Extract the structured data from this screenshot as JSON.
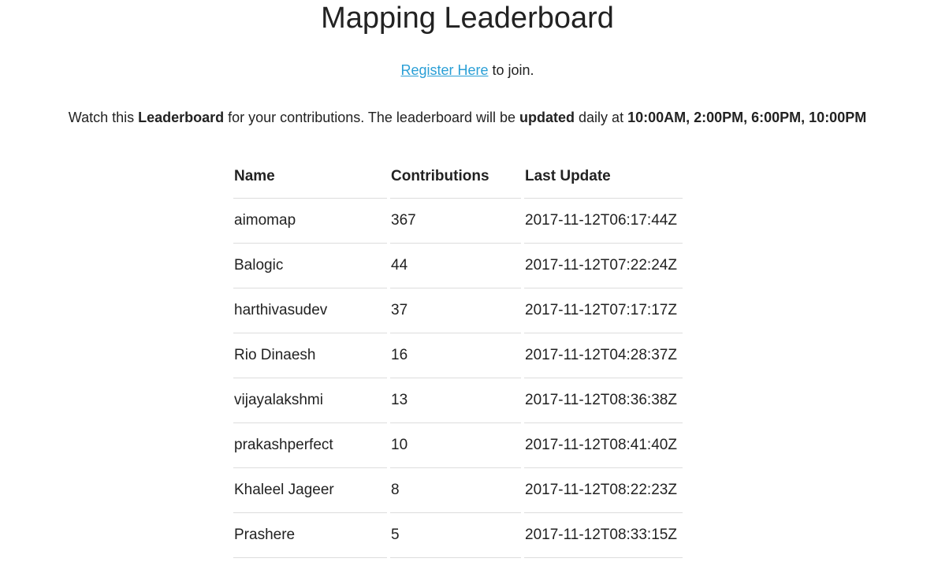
{
  "page": {
    "title": "Mapping Leaderboard"
  },
  "register": {
    "link_text": "Register Here",
    "suffix": " to join."
  },
  "info": {
    "part1": "Watch this ",
    "bold1": "Leaderboard",
    "part2": " for your contributions. The leaderboard will be ",
    "bold2": "updated",
    "part3": " daily at ",
    "bold3": "10:00AM, 2:00PM, 6:00PM, 10:00PM"
  },
  "table": {
    "headers": [
      "Name",
      "Contributions",
      "Last Update"
    ],
    "rows": [
      {
        "name": "aimomap",
        "contributions": "367",
        "last_update": "2017-11-12T06:17:44Z"
      },
      {
        "name": "Balogic",
        "contributions": "44",
        "last_update": "2017-11-12T07:22:24Z"
      },
      {
        "name": "harthivasudev",
        "contributions": "37",
        "last_update": "2017-11-12T07:17:17Z"
      },
      {
        "name": "Rio Dinaesh",
        "contributions": "16",
        "last_update": "2017-11-12T04:28:37Z"
      },
      {
        "name": "vijayalakshmi",
        "contributions": "13",
        "last_update": "2017-11-12T08:36:38Z"
      },
      {
        "name": "prakashperfect",
        "contributions": "10",
        "last_update": "2017-11-12T08:41:40Z"
      },
      {
        "name": "Khaleel Jageer",
        "contributions": "8",
        "last_update": "2017-11-12T08:22:23Z"
      },
      {
        "name": "Prashere",
        "contributions": "5",
        "last_update": "2017-11-12T08:33:15Z"
      }
    ]
  },
  "colors": {
    "link": "#2a9fd6",
    "text": "#222222",
    "divider": "#dddddd"
  }
}
